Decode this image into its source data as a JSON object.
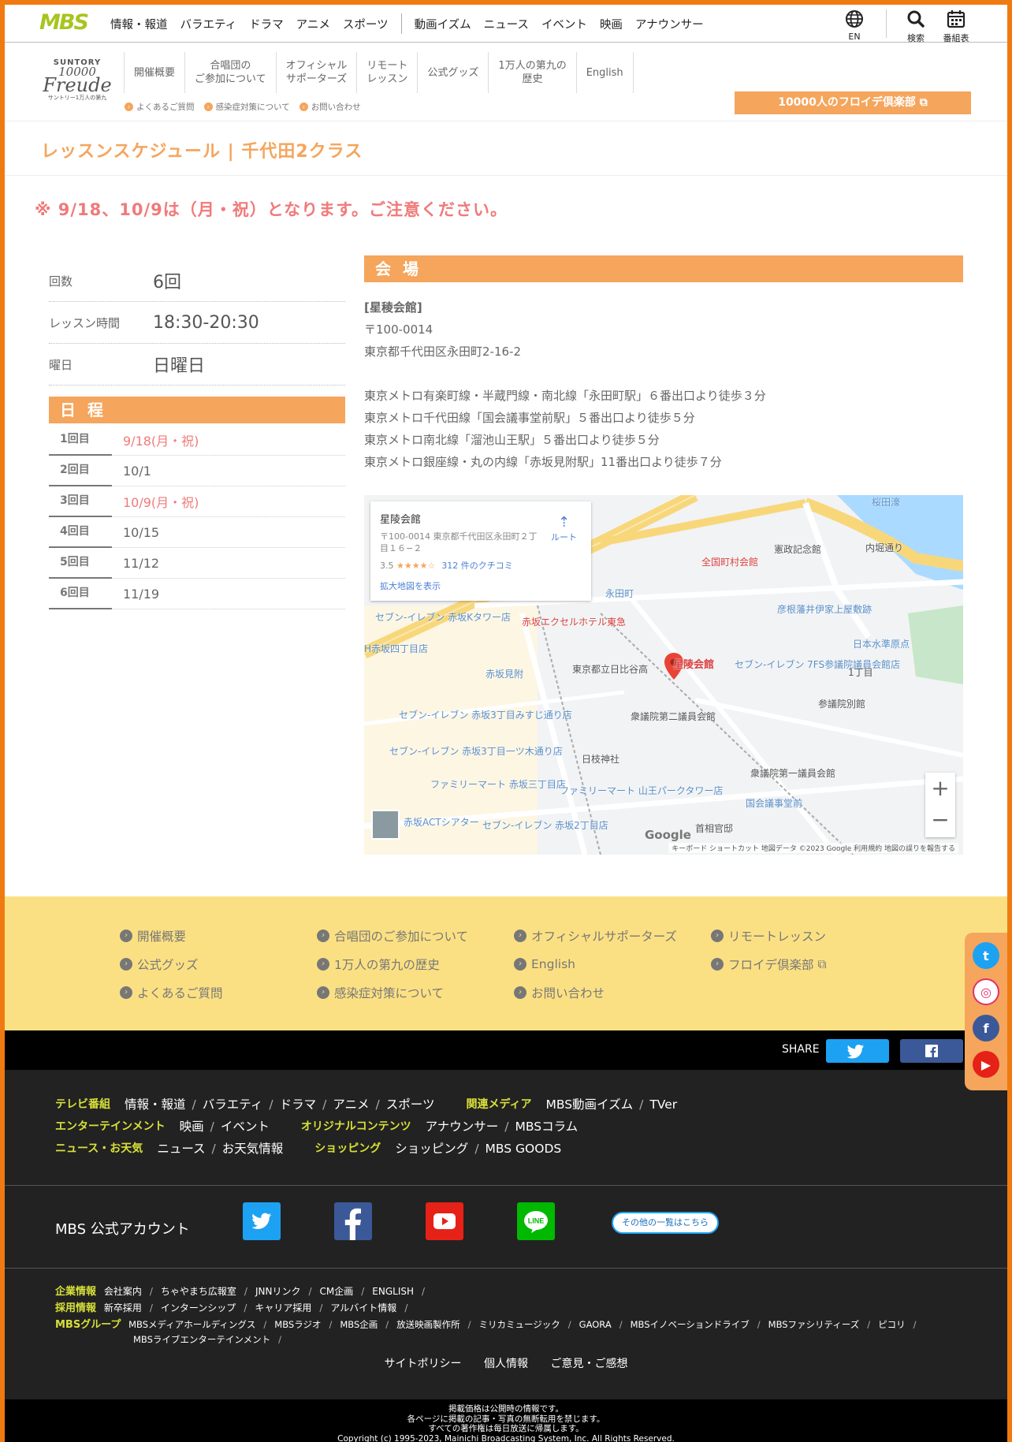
{
  "topnav": {
    "logo": "MBS",
    "items": [
      "情報・報道",
      "バラエティ",
      "ドラマ",
      "アニメ",
      "スポーツ"
    ],
    "items2": [
      "動画イズム",
      "ニュース",
      "イベント",
      "映画",
      "アナウンサー"
    ],
    "lang": "EN",
    "search": "検索",
    "schedule": "番組表"
  },
  "subhead": {
    "logo_top": "SUNTORY",
    "logo_num": "10000",
    "logo_word": "Freude",
    "logo_sub": "サントリー1万人の第九",
    "nav": [
      "開催概要",
      "合唱団の\nご参加について",
      "オフィシャル\nサポーターズ",
      "リモート\nレッスン",
      "公式グッズ",
      "1万人の第九の\n歴史",
      "English"
    ],
    "links": [
      "よくあるご質問",
      "感染症対策について",
      "お問い合わせ"
    ],
    "club_button": "10000人のフロイデ倶楽部"
  },
  "title": "レッスンスケジュール | 千代田2クラス",
  "notice": "※ 9/18、10/9は（月・祝）となります。ご注意ください。",
  "info": [
    {
      "k": "回数",
      "v": "6回"
    },
    {
      "k": "レッスン時間",
      "v": "18:30-20:30"
    },
    {
      "k": "曜日",
      "v": "日曜日"
    }
  ],
  "schedule_heading": "日 程",
  "schedule": [
    {
      "k": "1回目",
      "v": "9/18(月・祝)",
      "holiday": true
    },
    {
      "k": "2回目",
      "v": "10/1",
      "holiday": false
    },
    {
      "k": "3回目",
      "v": "10/9(月・祝)",
      "holiday": true
    },
    {
      "k": "4回目",
      "v": "10/15",
      "holiday": false
    },
    {
      "k": "5回目",
      "v": "11/12",
      "holiday": false
    },
    {
      "k": "6回目",
      "v": "11/19",
      "holiday": false
    }
  ],
  "venue_heading": "会 場",
  "venue": {
    "name": "[星稜会館]",
    "zip": "〒100-0014",
    "address": "東京都千代田区永田町2-16-2",
    "access": [
      "東京メトロ有楽町線・半蔵門線・南北線「永田町駅」６番出口より徒歩３分",
      "東京メトロ千代田線「国会議事堂前駅」５番出口より徒歩５分",
      "東京メトロ南北線「溜池山王駅」５番出口より徒歩５分",
      "東京メトロ銀座線・丸の内線「赤坂見附駅」11番出口より徒歩７分"
    ]
  },
  "map": {
    "card_title": "星陵会館",
    "card_address": "〒100-0014 東京都千代田区永田町２丁目１６−２",
    "rating": "3.5",
    "stars": "★★★★☆",
    "reviews": "312 件のクチコミ",
    "enlarge": "拡大地図を表示",
    "route": "ルート",
    "pin_label": "星陵会館",
    "labels": [
      "桜田濠",
      "憲政記念館",
      "内堀通り",
      "全国町村会館",
      "永田町",
      "日比谷高",
      "赤坂見附",
      "赤坂エクセルホテル東急",
      "セブン-イレブン 赤坂Kタワー店",
      "セブン-イレブン 7FS参議院議員会館店",
      "衆議院第二議員会館",
      "参議院別館",
      "日枝神社",
      "衆議院第一議員会館",
      "ファミリーマート 赤坂三丁目店",
      "ファミリーマート 山王パークタワー店",
      "国会議事堂前",
      "首相官邸",
      "彦根藩井伊家上屋敷跡",
      "日本水準原点",
      "1丁目",
      "東京都立日比谷高",
      "セブン-イレブン 赤坂3丁目みすじ通り店",
      "セブン-イレブン 赤坂3丁目一ツ木通り店",
      "セブン-イレブン 赤坂2丁目店",
      "赤坂ACTシアター",
      "H赤坂四丁目店"
    ],
    "google": "Google",
    "footer": "キーボード ショートカット 地図データ ©2023 Google 利用規約 地図の誤りを報告する",
    "zoom_in": "+",
    "zoom_out": "−"
  },
  "footer_links": [
    "開催概要",
    "合唱団のご参加について",
    "オフィシャルサポーターズ",
    "リモートレッスン",
    "公式グッズ",
    "1万人の第九の歴史",
    "English",
    "フロイデ倶楽部",
    "よくあるご質問",
    "感染症対策について",
    "お問い合わせ"
  ],
  "share": "SHARE",
  "footer_cats": {
    "tv": "テレビ番組",
    "tv_items": [
      "情報・報道",
      "バラエティ",
      "ドラマ",
      "アニメ",
      "スポーツ"
    ],
    "media": "関連メディア",
    "media_items": [
      "MBS動画イズム",
      "TVer"
    ],
    "ent": "エンターテインメント",
    "ent_items": [
      "映画",
      "イベント"
    ],
    "orig": "オリジナルコンテンツ",
    "orig_items": [
      "アナウンサー",
      "MBSコラム"
    ],
    "news": "ニュース・お天気",
    "news_items": [
      "ニュース",
      "お天気情報"
    ],
    "shop": "ショッピング",
    "shop_items": [
      "ショッピング",
      "MBS GOODS"
    ]
  },
  "accounts_label": "MBS 公式アカウント",
  "accounts_more": "その他の一覧はこちら",
  "corp": {
    "c1": "企業情報",
    "c1_items": [
      "会社案内",
      "ちゃやまち広報室",
      "JNNリンク",
      "CM企画",
      "ENGLISH"
    ],
    "c2": "採用情報",
    "c2_items": [
      "新卒採用",
      "インターンシップ",
      "キャリア採用",
      "アルバイト情報"
    ],
    "c3": "MBSグループ",
    "c3_items": [
      "MBSメディアホールディングス",
      "MBSラジオ",
      "MBS企画",
      "放送映画製作所",
      "ミリカミュージック",
      "GAORA",
      "MBSイノベーションドライブ",
      "MBSファシリティーズ",
      "ピコリ"
    ],
    "c3_items2": [
      "MBSライブエンターテインメント"
    ]
  },
  "policy": [
    "サイトポリシー",
    "個人情報",
    "ご意見・ご感想"
  ],
  "copyright": [
    "掲載価格は公開時の情報です。",
    "各ページに掲載の記事・写真の無断転用を禁じます。",
    "すべての著作権は毎日放送に帰属します。",
    "Copyright (c) 1995-2023, Mainichi Broadcasting System, Inc. All Rights Reserved."
  ]
}
